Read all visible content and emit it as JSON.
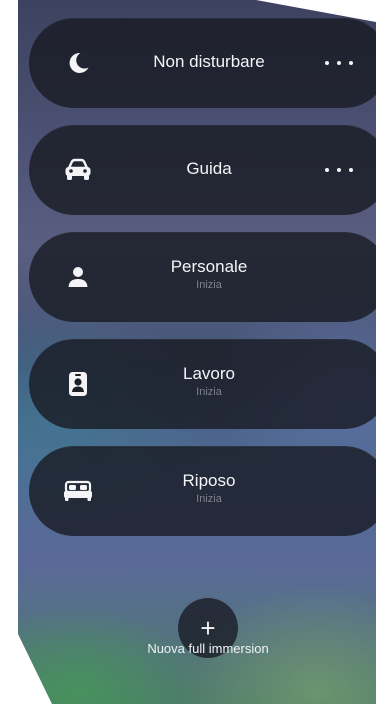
{
  "focus_modes": [
    {
      "title": "Non disturbare",
      "subtitle": "",
      "icon": "moon-icon",
      "has_more": true
    },
    {
      "title": "Guida",
      "subtitle": "",
      "icon": "car-icon",
      "has_more": true
    },
    {
      "title": "Personale",
      "subtitle": "Inizia",
      "icon": "person-icon",
      "has_more": false
    },
    {
      "title": "Lavoro",
      "subtitle": "Inizia",
      "icon": "id-badge-icon",
      "has_more": false
    },
    {
      "title": "Riposo",
      "subtitle": "Inizia",
      "icon": "bed-icon",
      "has_more": false
    }
  ],
  "add_button": {
    "symbol": "+",
    "label": "Nuova full immersion"
  }
}
